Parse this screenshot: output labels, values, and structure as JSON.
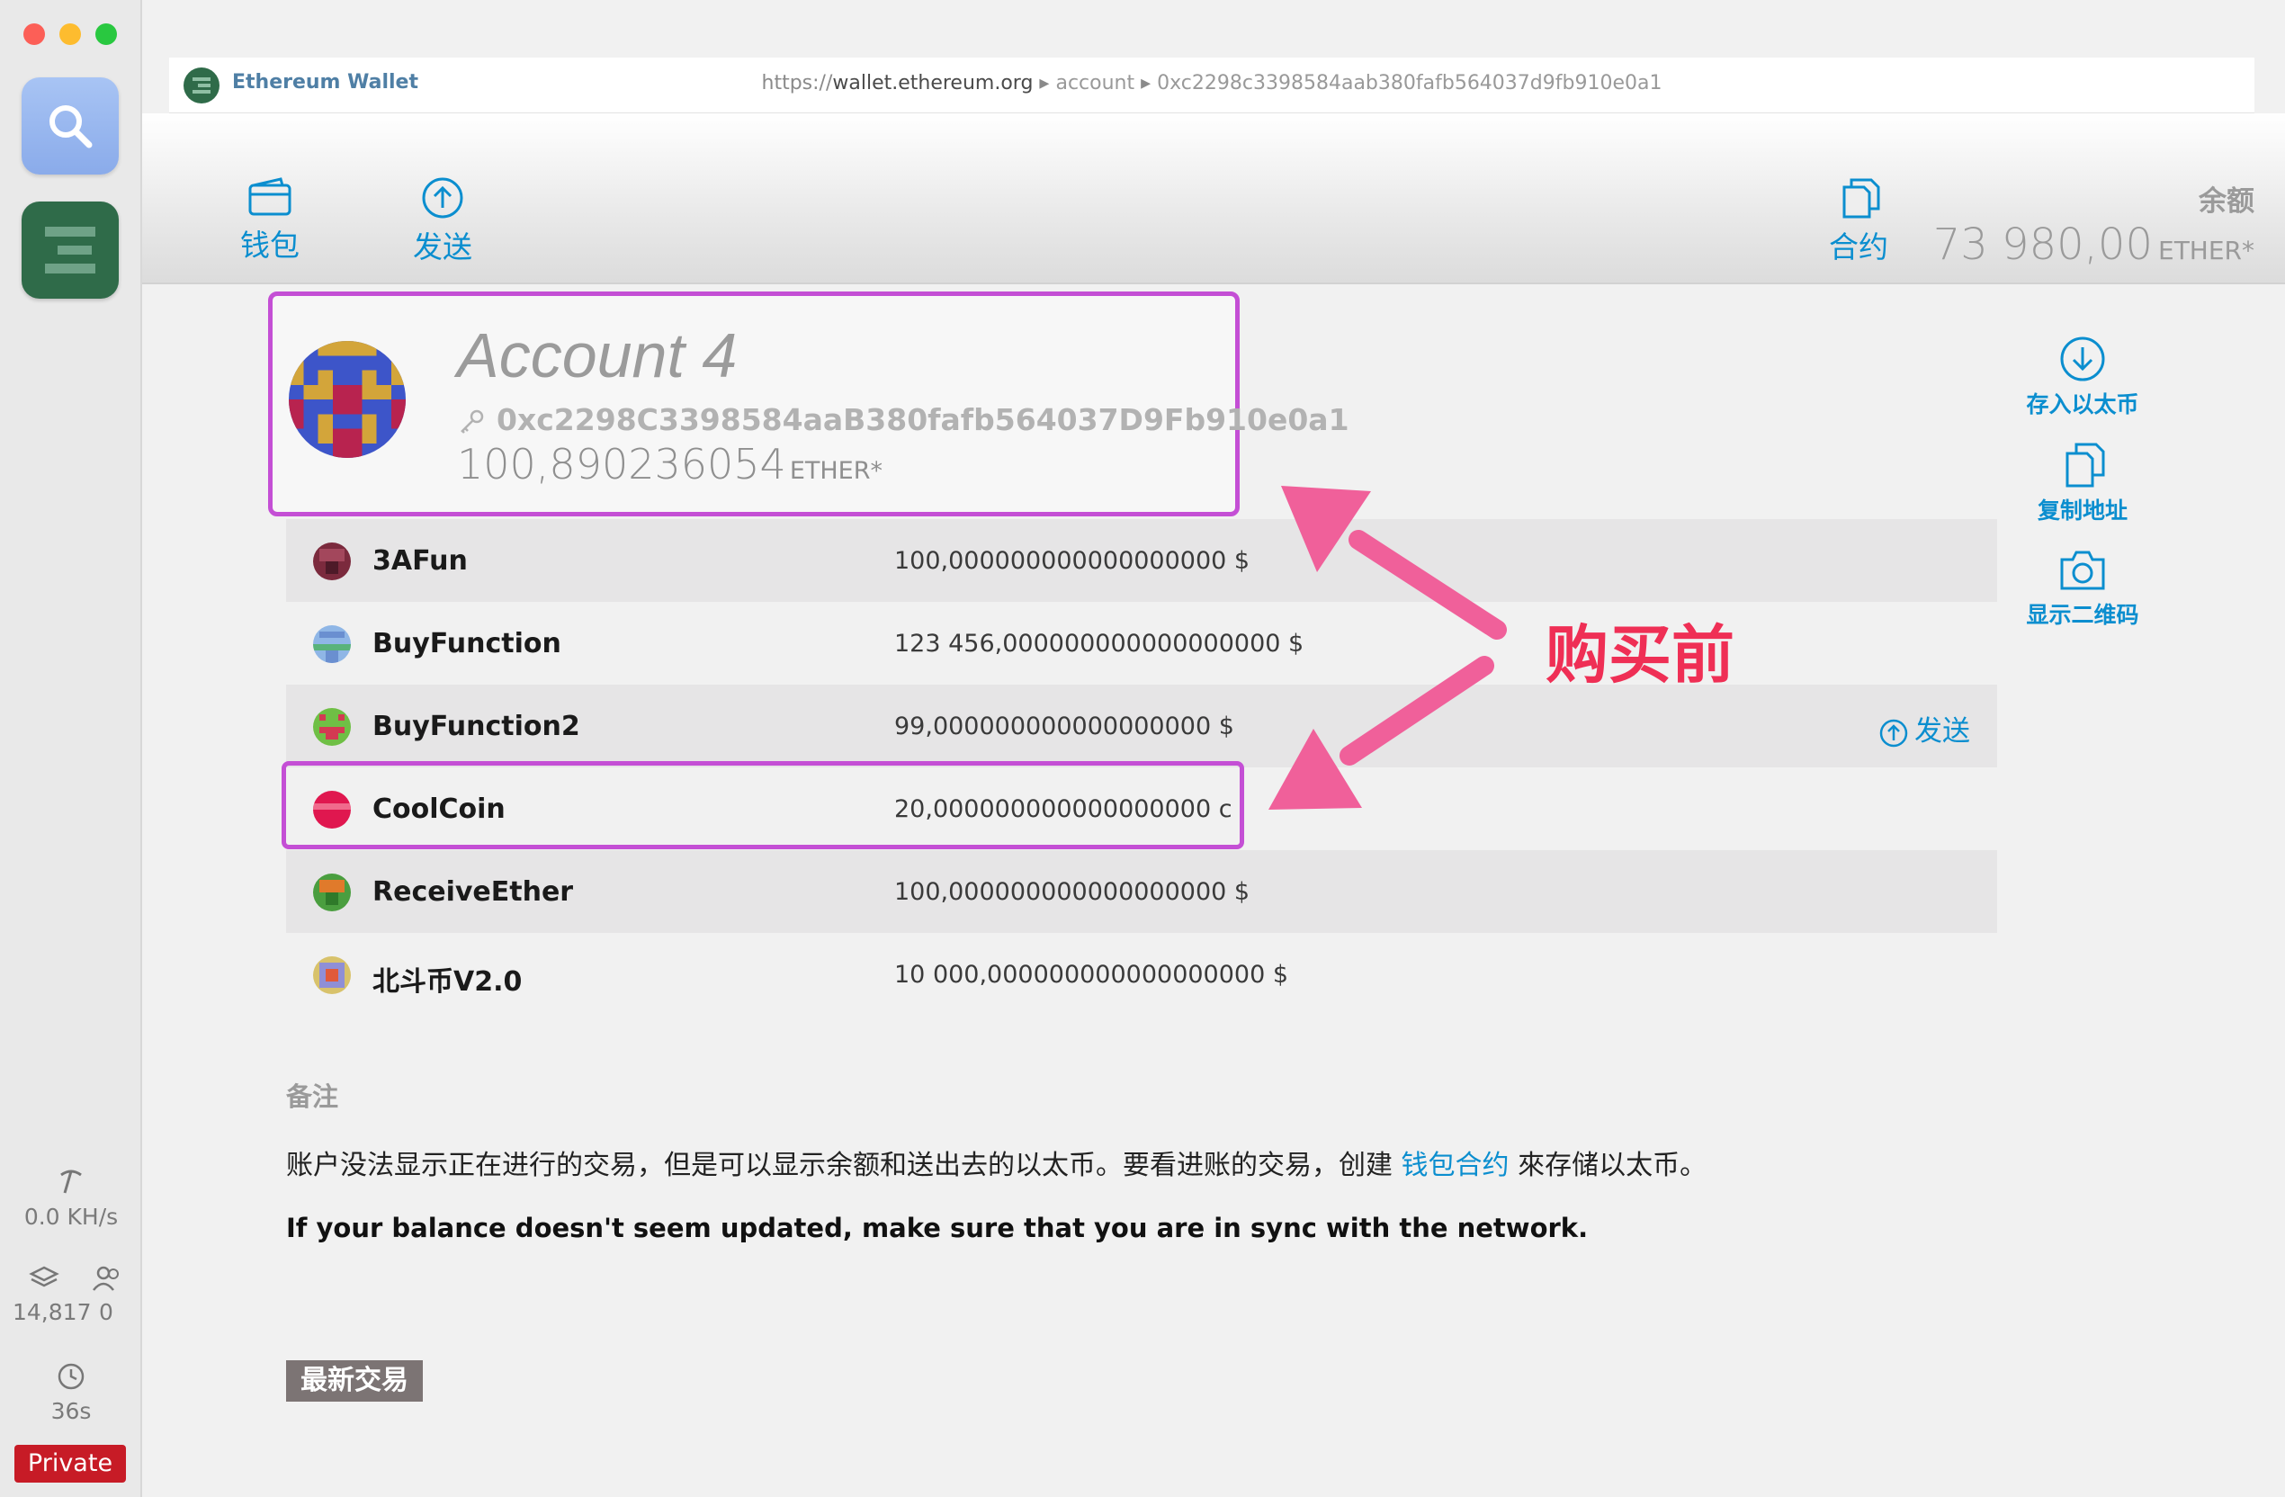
{
  "dock": {
    "hashrate": "0.0 KH/s",
    "blocks": "14,817",
    "peers": "0",
    "last_block": "36s",
    "network": "Private"
  },
  "addressbar": {
    "title": "Ethereum Wallet",
    "url_scheme": "https://",
    "url_host": "wallet.ethereum.org",
    "crumb1": "account",
    "crumb2": "0xc2298c3398584aab380fafb564037d9fb910e0a1"
  },
  "nav": {
    "wallets": "钱包",
    "send": "发送",
    "contracts": "合约",
    "balance_label": "余额",
    "balance_value": "73 980,00",
    "balance_unit": "ETHER*"
  },
  "account": {
    "name": "Account 4",
    "address": "0xc2298C3398584aaB380fafb564037D9Fb910e0a1",
    "balance": "100,890236054",
    "unit": "ETHER*"
  },
  "actions": {
    "deposit": "存入以太币",
    "copy": "复制地址",
    "qr": "显示二维码"
  },
  "tokens": [
    {
      "name": "3AFun",
      "value": "100,000000000000000000 $"
    },
    {
      "name": "BuyFunction",
      "value": "123 456,000000000000000000 $"
    },
    {
      "name": "BuyFunction2",
      "value": "99,000000000000000000 $",
      "action": "发送"
    },
    {
      "name": "CoolCoin",
      "value": "20,000000000000000000 c"
    },
    {
      "name": "ReceiveEther",
      "value": "100,000000000000000000 $"
    },
    {
      "name": "北斗币V2.0",
      "value": "10 000,000000000000000000 $"
    }
  ],
  "annotation": {
    "text": "购买前",
    "color": "#ef2f55"
  },
  "notes": {
    "title": "备注",
    "zh_before": "账户没法显示正在进行的交易，但是可以显示余额和送出去的以太币。要看进账的交易，创建 ",
    "zh_link": "钱包合约",
    "zh_after": " 來存储以太币。",
    "en": "If your balance doesn't seem updated, make sure that you are in sync with the network."
  },
  "latest_transactions": "最新交易",
  "colors": {
    "accent": "#0b8ecf",
    "highlight_border": "#c44fd5",
    "private": "#c71b26"
  }
}
